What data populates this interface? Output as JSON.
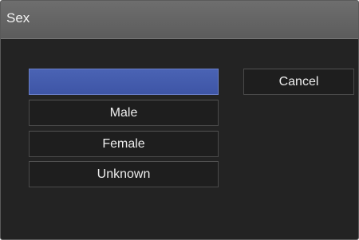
{
  "dialog": {
    "title": "Sex"
  },
  "options": [
    {
      "label": "",
      "selected": true
    },
    {
      "label": "Male",
      "selected": false
    },
    {
      "label": "Female",
      "selected": false
    },
    {
      "label": "Unknown",
      "selected": false
    }
  ],
  "cancel_label": "Cancel",
  "colors": {
    "selected": "#4257AA",
    "titlebar": "#666666",
    "background": "#222222"
  }
}
